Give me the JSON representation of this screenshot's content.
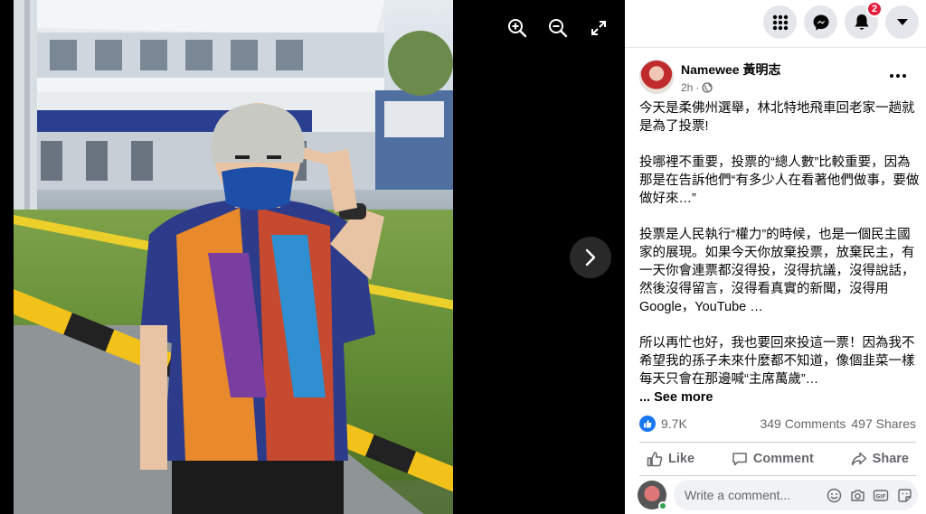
{
  "viewer": {
    "zoom_in_icon": "zoom-in-icon",
    "zoom_out_icon": "zoom-out-icon",
    "fullscreen_icon": "expand-icon",
    "next_icon": "chevron-right-icon"
  },
  "topbar": {
    "menu_icon": "grid-menu-icon",
    "messenger_icon": "messenger-icon",
    "notifications_icon": "bell-icon",
    "notifications_count": "2",
    "account_icon": "caret-down-icon"
  },
  "post": {
    "author": "Namewee 黃明志",
    "time": "2h",
    "paragraphs": [
      "今天是柔佛州選舉，林北特地飛車回老家一趟就是為了投票!",
      "投哪裡不重要，投票的“總人數”比較重要，因為那是在告訴他們“有多少人在看著他們做事，要做做好來…”",
      "投票是人民執行“權力”的時候，也是一個民主國家的展現。如果今天你放棄投票，放棄民主，有一天你會連票都沒得投，沒得抗議，沒得說話，然後沒得留言，沒得看真實的新聞，沒得用Google，YouTube …",
      "所以再忙也好，我也要回來投這一票！因為我不希望我的孫子未來什麼都不知道，像個韭菜一樣每天只會在那邊喊“主席萬歲”…"
    ],
    "see_more": "... See more"
  },
  "stats": {
    "likes": "9.7K",
    "comments": "349 Comments",
    "shares": "497 Shares"
  },
  "actions": {
    "like": "Like",
    "comment": "Comment",
    "share": "Share"
  },
  "comment_box": {
    "placeholder": "Write a comment..."
  },
  "colors": {
    "accent": "#1877f2",
    "badge": "#e41e3f",
    "viewer_bg": "#000000"
  }
}
